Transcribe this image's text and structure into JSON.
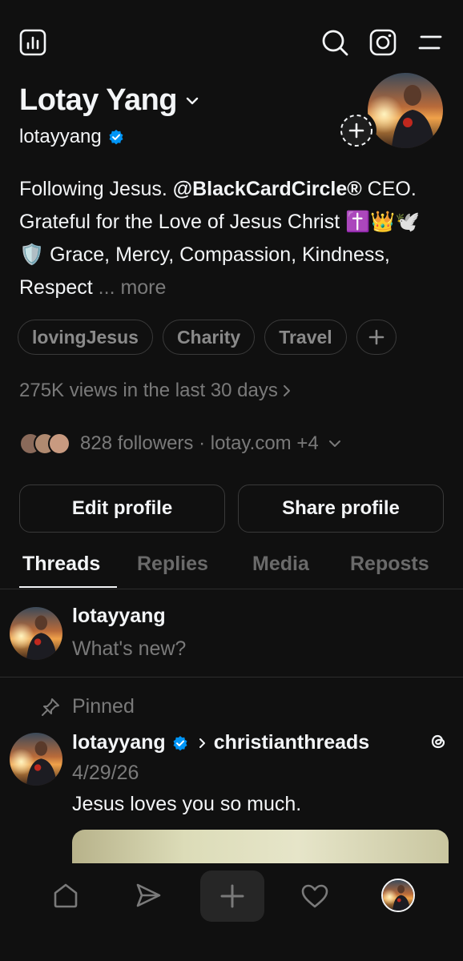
{
  "profile": {
    "name": "Lotay Yang",
    "handle": "lotayyang",
    "bio_line1_plain": "Following Jesus. ",
    "bio_line1_bold": "@BlackCardCircle®",
    "bio_rest": "CEO. Grateful for the Love of Jesus Christ",
    "bio_emojis": "✝️👑🕊️🛡️",
    "bio_tail": "Grace, Mercy, Compassion, Kindness, Respect",
    "bio_more": "... more",
    "tags": [
      "lovingJesus",
      "Charity",
      "Travel"
    ],
    "views_text": "275K views in the last 30 days",
    "followers_text": "828 followers · lotay.com +4"
  },
  "buttons": {
    "edit": "Edit profile",
    "share": "Share profile"
  },
  "tabs": [
    "Threads",
    "Replies",
    "Media",
    "Reposts"
  ],
  "composer": {
    "username": "lotayyang",
    "placeholder": "What's new?"
  },
  "post": {
    "pinned_label": "Pinned",
    "author": "lotayyang",
    "community": "christianthreads",
    "date": "4/29/26",
    "text": "Jesus loves you so much."
  },
  "colors": {
    "background": "#101010",
    "text": "#f3f5f7",
    "muted": "#7a7a7a",
    "verified": "#0095f6"
  },
  "icons": {
    "top_left": "insights-icon",
    "search": "search-icon",
    "instagram": "instagram-icon",
    "menu": "menu-icon",
    "nav": [
      "home-icon",
      "send-icon",
      "plus-icon",
      "heart-icon",
      "profile-avatar"
    ]
  }
}
